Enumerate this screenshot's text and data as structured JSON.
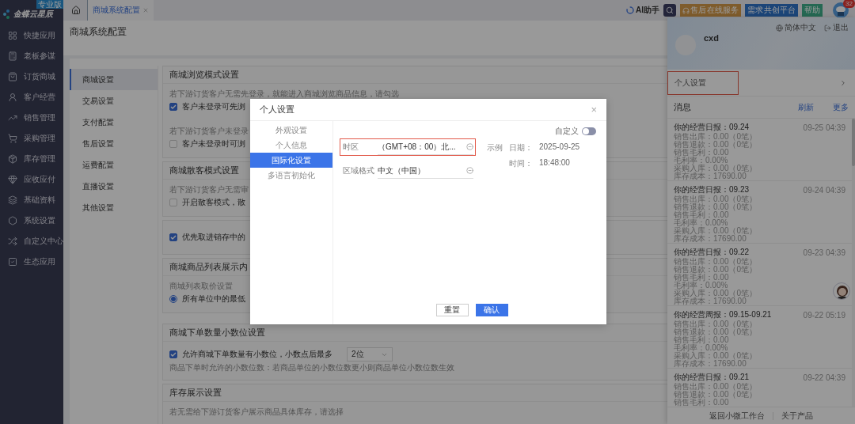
{
  "logo": {
    "name": "金蝶云星辰",
    "edition": "专业版"
  },
  "sidebar": {
    "items": [
      {
        "label": "快捷应用"
      },
      {
        "label": "老板参谋"
      },
      {
        "label": "订货商城"
      },
      {
        "label": "客户经营"
      },
      {
        "label": "销售管理"
      },
      {
        "label": "采购管理"
      },
      {
        "label": "库存管理"
      },
      {
        "label": "应收应付"
      },
      {
        "label": "基础资料"
      },
      {
        "label": "系统设置"
      },
      {
        "label": "自定义中心"
      },
      {
        "label": "生态应用"
      }
    ]
  },
  "tabs": [
    {
      "label": "商城系统配置",
      "selected": true
    }
  ],
  "topbar": {
    "ai_label": "AI助手",
    "service_button": {
      "main": "售后",
      "sub": "在线服务"
    },
    "demand_button": {
      "main": "需求",
      "sub": "共创平台"
    },
    "help_button": "帮助",
    "badge": "32"
  },
  "page": {
    "title": "商城系统配置",
    "subnav": [
      {
        "label": "商城设置",
        "selected": true
      },
      {
        "label": "交易设置",
        "selected": false
      },
      {
        "label": "支付配置",
        "selected": false
      },
      {
        "label": "售后设置",
        "selected": false
      },
      {
        "label": "运费配置",
        "selected": false
      },
      {
        "label": "直播设置",
        "selected": false
      },
      {
        "label": "其他设置",
        "selected": false
      }
    ],
    "cards": [
      {
        "title": "商城浏览模式设置",
        "rows": [
          {
            "kind": "desc",
            "text": "若下游订货客户无需先登录，就能进入商城浏览商品信息，请勾选"
          },
          {
            "kind": "checkbox",
            "text": "客户未登录可先浏",
            "checked": true
          },
          {
            "kind": "desc",
            "text": "若下游订货客户未登录"
          },
          {
            "kind": "checkbox",
            "text": "客户未登录时可浏",
            "checked": false
          }
        ]
      },
      {
        "title": "商城散客模式设置",
        "rows": [
          {
            "kind": "desc",
            "text": "若下游订货客户无需审"
          },
          {
            "kind": "checkbox",
            "text": "开启散客模式，散",
            "checked": false
          }
        ]
      },
      {
        "rows": [
          {
            "kind": "checkbox",
            "text": "优先取进销存中的",
            "checked": true
          }
        ]
      },
      {
        "title": "商城商品列表展示内",
        "rows": [
          {
            "kind": "desc",
            "text": "商城列表取价设置"
          },
          {
            "kind": "radio",
            "text": "所有单位中的最低",
            "checked": true
          }
        ]
      },
      {
        "title": "商城下单数量小数位设置",
        "rows": [
          {
            "kind": "checkbox-select",
            "text": "允许商城下单数量有小数位，小数点后最多",
            "checked": true,
            "value": "2位"
          },
          {
            "kind": "desc",
            "text": "商品下单时允许的小数位数：若商品单位的小数位数更小则商品单位小数位数生效"
          }
        ]
      },
      {
        "title": "库存展示设置",
        "rows": [
          {
            "kind": "desc",
            "text": "若无需给下游订货客户展示商品具体库存，请选择"
          }
        ]
      }
    ]
  },
  "modal": {
    "title": "个人设置",
    "close": "×",
    "nav": [
      {
        "label": "外观设置",
        "selected": false
      },
      {
        "label": "个人信息",
        "selected": false
      },
      {
        "label": "国际化设置",
        "selected": true
      },
      {
        "label": "多语言初始化",
        "selected": false
      }
    ],
    "toggle": {
      "label": "自定义",
      "on": false
    },
    "fields": [
      {
        "label": "时区",
        "value": "（GMT+08：00）北...",
        "highlighted": true
      },
      {
        "label": "区域格式",
        "value": "中文（中国）",
        "highlighted": false
      }
    ],
    "example": {
      "label": "示例",
      "items": [
        {
          "label": "日期：",
          "value": "2025-09-25"
        },
        {
          "label": "时间：",
          "value": "18:48:00"
        }
      ]
    },
    "buttons": [
      {
        "label": "重置",
        "kind": "default"
      },
      {
        "label": "确认",
        "kind": "primary"
      }
    ]
  },
  "user_panel": {
    "language": "简体中文",
    "logout": "退出",
    "username": "cxd",
    "settings_row": {
      "label": "个人设置",
      "highlighted": true
    },
    "messages": {
      "title": "消息",
      "actions": [
        "刷新",
        "更多"
      ],
      "items": [
        {
          "title": "你的经营日报：09.24",
          "time": "09-25 04:39",
          "lines": [
            "销售出库：0.00（0笔）",
            "销售退款：0.00（0笔）",
            "销售毛利：0.00",
            "毛利率：0.00%",
            "采购入库：0.00（0笔）",
            "库存成本：17690.00"
          ]
        },
        {
          "title": "你的经营日报：09.23",
          "time": "09-24 04:39",
          "lines": [
            "销售出库：0.00（0笔）",
            "销售退款：0.00（0笔）",
            "销售毛利：0.00",
            "毛利率：0.00%",
            "采购入库：0.00（0笔）",
            "库存成本：17690.00"
          ]
        },
        {
          "title": "你的经营日报：09.22",
          "time": "09-23 04:39",
          "lines": [
            "销售出库：0.00（0笔）",
            "销售退款：0.00（0笔）",
            "销售毛利：0.00",
            "毛利率：0.00%",
            "采购入库：0.00（0笔）",
            "库存成本：17690.00"
          ]
        },
        {
          "title": "你的经营周报：09.15-09.21",
          "time": "09-22 05:19",
          "lines": [
            "销售出库：0.00（0笔）",
            "销售退款：0.00（0笔）",
            "销售毛利：0.00",
            "毛利率：0.00%",
            "采购入库：0.00（0笔）",
            "库存成本：17690.00"
          ]
        },
        {
          "title": "你的经营日报：09.21",
          "time": "09-22 04:39",
          "lines": [
            "销售出库：0.00（0笔）",
            "销售退款：0.00（0笔）",
            "销售毛利：0.00"
          ]
        }
      ]
    },
    "footer": [
      "返回小微工作台",
      "关于产品"
    ]
  }
}
